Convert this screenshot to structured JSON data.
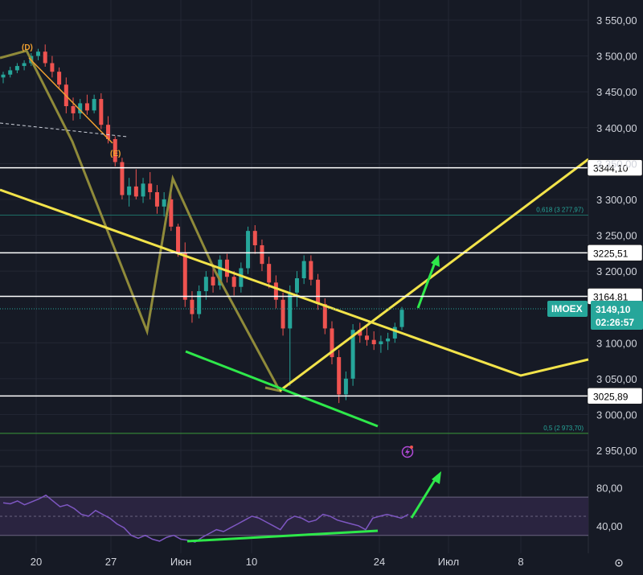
{
  "chart_data": {
    "type": "candlestick",
    "symbol": "IMOEX",
    "last_price": "3149,10",
    "countdown": "02:26:57",
    "y_ticks": [
      "3 550,00",
      "3 500,00",
      "3 450,00",
      "3 400,00",
      "3 350,00",
      "3 300,00",
      "3 250,00",
      "3 200,00",
      "3 100,00",
      "3 050,00",
      "3 000,00",
      "2 950,00"
    ],
    "y_tick_values": [
      3550,
      3500,
      3450,
      3400,
      3350,
      3300,
      3250,
      3200,
      3100,
      3050,
      3000,
      2950
    ],
    "ylim": [
      2940,
      3570
    ],
    "x_ticks": [
      "20",
      "27",
      "Июн",
      "10",
      "24",
      "Июл",
      "8"
    ],
    "levels": [
      {
        "label": "3344,10",
        "value": 3344.1
      },
      {
        "label": "3225,51",
        "value": 3225.51
      },
      {
        "label": "3164,81",
        "value": 3164.81
      },
      {
        "label": "3025,89",
        "value": 3025.89
      }
    ],
    "fib_levels": [
      {
        "label": "0,618 (3 277,97)",
        "value": 3277.97
      },
      {
        "label": "0,5 (2 973,70)",
        "value": 2973.7
      }
    ],
    "wave_labels": [
      "(D)",
      "(E)"
    ],
    "rsi": {
      "y_ticks": [
        "80,00",
        "40,00"
      ],
      "y_tick_values": [
        80,
        40
      ],
      "ylim": [
        18,
        92
      ],
      "band": [
        70,
        30
      ]
    },
    "candles": [
      [
        3470,
        3478,
        3462,
        3474
      ],
      [
        3474,
        3485,
        3470,
        3480
      ],
      [
        3480,
        3490,
        3476,
        3486
      ],
      [
        3486,
        3494,
        3480,
        3490
      ],
      [
        3490,
        3504,
        3486,
        3500
      ],
      [
        3500,
        3510,
        3494,
        3506
      ],
      [
        3506,
        3516,
        3485,
        3490
      ],
      [
        3490,
        3500,
        3470,
        3478
      ],
      [
        3478,
        3484,
        3455,
        3460
      ],
      [
        3460,
        3470,
        3420,
        3430
      ],
      [
        3430,
        3442,
        3410,
        3420
      ],
      [
        3420,
        3440,
        3412,
        3434
      ],
      [
        3434,
        3446,
        3418,
        3424
      ],
      [
        3424,
        3446,
        3420,
        3440
      ],
      [
        3440,
        3448,
        3398,
        3404
      ],
      [
        3404,
        3416,
        3378,
        3384
      ],
      [
        3384,
        3388,
        3346,
        3352
      ],
      [
        3352,
        3358,
        3300,
        3306
      ],
      [
        3306,
        3330,
        3290,
        3318
      ],
      [
        3318,
        3342,
        3300,
        3304
      ],
      [
        3304,
        3330,
        3295,
        3322
      ],
      [
        3322,
        3338,
        3300,
        3310
      ],
      [
        3310,
        3320,
        3280,
        3290
      ],
      [
        3290,
        3310,
        3276,
        3300
      ],
      [
        3300,
        3318,
        3256,
        3262
      ],
      [
        3262,
        3266,
        3220,
        3226
      ],
      [
        3226,
        3240,
        3150,
        3160
      ],
      [
        3160,
        3172,
        3128,
        3140
      ],
      [
        3140,
        3180,
        3134,
        3172
      ],
      [
        3172,
        3200,
        3160,
        3192
      ],
      [
        3192,
        3210,
        3170,
        3180
      ],
      [
        3180,
        3222,
        3174,
        3216
      ],
      [
        3216,
        3224,
        3184,
        3192
      ],
      [
        3192,
        3200,
        3166,
        3178
      ],
      [
        3178,
        3212,
        3170,
        3204
      ],
      [
        3204,
        3262,
        3196,
        3256
      ],
      [
        3256,
        3264,
        3224,
        3236
      ],
      [
        3236,
        3244,
        3200,
        3210
      ],
      [
        3210,
        3220,
        3176,
        3184
      ],
      [
        3184,
        3194,
        3148,
        3160
      ],
      [
        3160,
        3170,
        3110,
        3120
      ],
      [
        3120,
        3180,
        3040,
        3170
      ],
      [
        3170,
        3200,
        3150,
        3190
      ],
      [
        3190,
        3222,
        3182,
        3214
      ],
      [
        3214,
        3222,
        3180,
        3188
      ],
      [
        3188,
        3196,
        3146,
        3154
      ],
      [
        3154,
        3162,
        3112,
        3120
      ],
      [
        3120,
        3130,
        3070,
        3080
      ],
      [
        3080,
        3090,
        3016,
        3028
      ],
      [
        3028,
        3060,
        3020,
        3050
      ],
      [
        3050,
        3126,
        3040,
        3118
      ],
      [
        3118,
        3128,
        3100,
        3110
      ],
      [
        3110,
        3122,
        3096,
        3104
      ],
      [
        3104,
        3116,
        3090,
        3098
      ],
      [
        3098,
        3110,
        3086,
        3102
      ],
      [
        3102,
        3114,
        3090,
        3106
      ],
      [
        3106,
        3128,
        3100,
        3122
      ],
      [
        3122,
        3150,
        3118,
        3146
      ]
    ],
    "rsi_values": [
      64,
      63,
      66,
      62,
      65,
      68,
      72,
      66,
      60,
      62,
      58,
      52,
      50,
      56,
      52,
      48,
      42,
      38,
      30,
      27,
      30,
      26,
      24,
      28,
      30,
      26,
      25,
      23,
      28,
      32,
      36,
      34,
      38,
      42,
      46,
      50,
      48,
      44,
      40,
      36,
      46,
      50,
      48,
      44,
      46,
      52,
      50,
      46,
      44,
      42,
      40,
      36,
      48,
      50,
      52,
      50,
      48,
      52
    ]
  }
}
